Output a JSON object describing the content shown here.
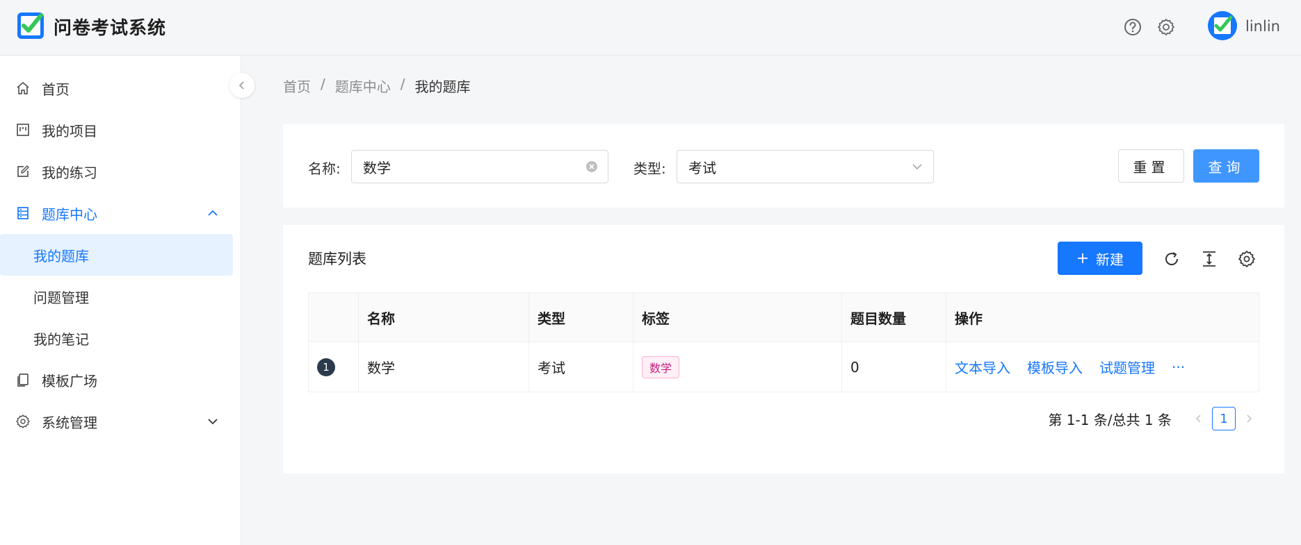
{
  "app": {
    "title": "问卷考试系统",
    "username": "linlin"
  },
  "header": {
    "icons": [
      "help-icon",
      "settings-icon"
    ]
  },
  "sidebar": {
    "items": [
      {
        "label": "首页",
        "icon": "home-icon"
      },
      {
        "label": "我的项目",
        "icon": "project-icon"
      },
      {
        "label": "我的练习",
        "icon": "edit-icon"
      },
      {
        "label": "题库中心",
        "icon": "database-icon",
        "expanded": true
      },
      {
        "label": "我的题库",
        "selected": true
      },
      {
        "label": "问题管理"
      },
      {
        "label": "我的笔记"
      },
      {
        "label": "模板广场",
        "icon": "copy-icon"
      },
      {
        "label": "系统管理",
        "icon": "gear-icon",
        "expanded": false
      }
    ]
  },
  "breadcrumb": [
    "首页",
    "/",
    "题库中心",
    "/",
    "我的题库"
  ],
  "search": {
    "name_label": "名称:",
    "name_value": "数学",
    "type_label": "类型:",
    "type_value": "考试",
    "reset_label": "重置",
    "query_label": "查询"
  },
  "table": {
    "title": "题库列表",
    "new_label": "新建",
    "columns": [
      "",
      "名称",
      "类型",
      "标签",
      "题目数量",
      "操作"
    ],
    "rows": [
      {
        "index": "1",
        "name": "数学",
        "type": "考试",
        "tag": "数学",
        "count": "0",
        "actions": [
          "文本导入",
          "模板导入",
          "试题管理",
          "···"
        ]
      }
    ],
    "pagination": {
      "summary": "第 1-1 条/总共 1 条",
      "current_page": "1"
    }
  },
  "colors": {
    "primary": "#1677ff",
    "query_button": "#4096ff",
    "tag_text": "#c41d7f"
  }
}
